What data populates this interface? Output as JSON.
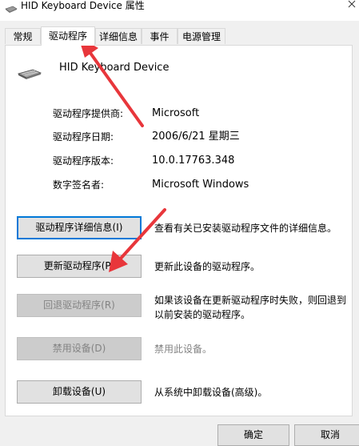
{
  "window": {
    "title": "HID Keyboard Device 属性"
  },
  "tabs": [
    {
      "label": "常规",
      "active": false
    },
    {
      "label": "驱动程序",
      "active": true
    },
    {
      "label": "详细信息",
      "active": false
    },
    {
      "label": "事件",
      "active": false
    },
    {
      "label": "电源管理",
      "active": false
    }
  ],
  "device": {
    "name": "HID Keyboard Device",
    "icon": "keyboard-icon"
  },
  "info": {
    "provider_label": "驱动程序提供商:",
    "provider_value": "Microsoft",
    "date_label": "驱动程序日期:",
    "date_value": "2006/6/21 星期三",
    "version_label": "驱动程序版本:",
    "version_value": "10.0.17763.348",
    "signer_label": "数字签名者:",
    "signer_value": "Microsoft Windows"
  },
  "actions": {
    "details_label": "驱动程序详细信息(I)",
    "details_desc": "查看有关已安装驱动程序文件的详细信息。",
    "update_label": "更新驱动程序(P)",
    "update_desc": "更新此设备的驱动程序。",
    "rollback_label": "回退驱动程序(R)",
    "rollback_desc": "如果该设备在更新驱动程序时失败，则回退到以前安装的驱动程序。",
    "disable_label": "禁用设备(D)",
    "disable_desc": "禁用此设备。",
    "uninstall_label": "卸载设备(U)",
    "uninstall_desc": "从系统中卸载设备(高级)。"
  },
  "footer": {
    "ok_label": "确定",
    "cancel_label": "取消"
  },
  "colors": {
    "focus_border": "#0078d7",
    "annotation_arrow": "#e8363b",
    "disabled_text": "#838383"
  }
}
